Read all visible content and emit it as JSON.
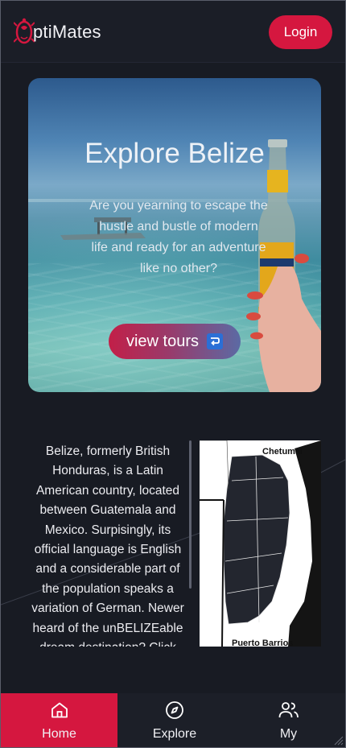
{
  "header": {
    "logo_text": "ptiMates",
    "login_label": "Login"
  },
  "hero": {
    "title": "Explore Belize",
    "text": "Are you yearning to escape the hustle and bustle of modern life and ready for an adventure like no other?",
    "button_label": "view tours",
    "button_icon": "return-arrow-icon"
  },
  "info": {
    "text": "Belize, formerly British Honduras, is a Latin American country, located between Guatemala and Mexico. Surpisingly, its official language is English and a considerable part of the population speaks a variation of German. Newer heard of the unBELIZEable dream destination? Click the"
  },
  "map": {
    "label_top": "Chetumal",
    "label_bottom": "Puerto Barrios"
  },
  "nav": {
    "items": [
      {
        "label": "Home",
        "icon": "home-icon",
        "active": true
      },
      {
        "label": "Explore",
        "icon": "compass-icon",
        "active": false
      },
      {
        "label": "My",
        "icon": "users-icon",
        "active": false
      }
    ]
  },
  "colors": {
    "accent": "#d5173f",
    "background": "#181b23",
    "header": "#1b1e27"
  }
}
